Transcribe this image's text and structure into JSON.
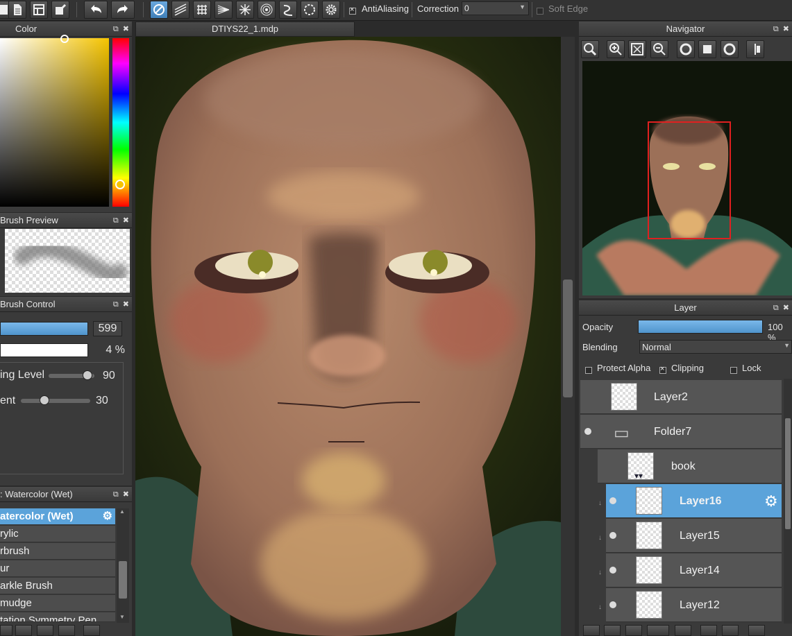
{
  "toolbar": {
    "antialiasing_label": "AntiAliasing",
    "correction_label": "Correction",
    "correction_value": "0",
    "soft_edge_label": "Soft Edge"
  },
  "document_tab": "DTIYS22_1.mdp",
  "color_panel": {
    "title": "Color"
  },
  "brush_preview": {
    "title": "Brush Preview"
  },
  "brush_control": {
    "title": "Brush Control",
    "size_value": "599",
    "opacity_value": "4 %",
    "level_label": "ing Level",
    "level_value": "90",
    "level_fraction": 0.9,
    "blend_label": "ent",
    "blend_value": "30",
    "blend_fraction": 0.3
  },
  "brush_list": {
    "title": ": Watercolor (Wet)",
    "items": [
      "atercolor (Wet)",
      "rylic",
      "rbrush",
      "ur",
      "arkle Brush",
      "mudge",
      "tation Symmetry Pen"
    ]
  },
  "navigator": {
    "title": "Navigator"
  },
  "layer_panel": {
    "title": "Layer",
    "opacity_label": "Opacity",
    "opacity_value": "100 %",
    "opacity_fraction": 1.0,
    "blending_label": "Blending",
    "blending_value": "Normal",
    "protect_alpha_label": "Protect Alpha",
    "clipping_label": "Clipping",
    "lock_label": "Lock",
    "layers": [
      "Layer2",
      "Folder7",
      "book",
      "Layer16",
      "Layer15",
      "Layer14",
      "Layer12"
    ]
  },
  "colors": {
    "accent": "#5ba3da",
    "background": "#2b2b2b",
    "canvas_bg": "#1c2410"
  }
}
